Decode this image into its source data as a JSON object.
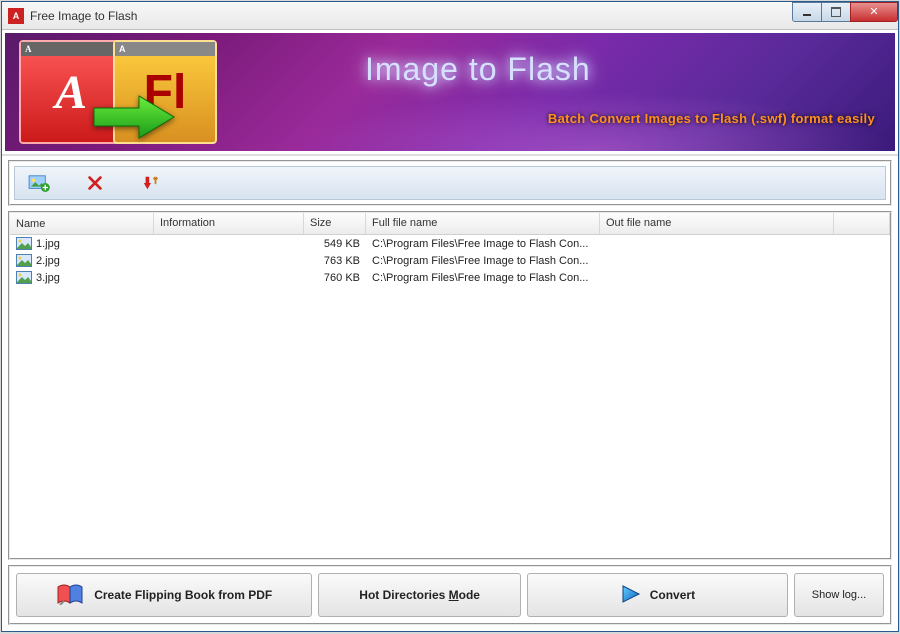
{
  "window": {
    "title": "Free Image to Flash"
  },
  "banner": {
    "title": "Image to Flash",
    "subtitle": "Batch Convert  Images to Flash (.swf) format easily",
    "logo_left_bar": "A",
    "logo_left_text": "A",
    "logo_right_bar": "A",
    "logo_right_text": "Fl"
  },
  "list": {
    "headers": {
      "name": "Name",
      "info": "Information",
      "size": "Size",
      "full": "Full file name",
      "out": "Out file name"
    },
    "rows": [
      {
        "name": "1.jpg",
        "info": "",
        "size": "549 KB",
        "full": "C:\\Program Files\\Free Image to Flash Con...",
        "out": ""
      },
      {
        "name": "2.jpg",
        "info": "",
        "size": "763 KB",
        "full": "C:\\Program Files\\Free Image to Flash Con...",
        "out": ""
      },
      {
        "name": "3.jpg",
        "info": "",
        "size": "760 KB",
        "full": "C:\\Program Files\\Free Image to Flash Con...",
        "out": ""
      }
    ]
  },
  "buttons": {
    "create_book": "Create Flipping Book  from PDF",
    "hot_dirs_pre": "Hot Directories ",
    "hot_dirs_key": "M",
    "hot_dirs_post": "ode",
    "convert": "Convert",
    "show_log": "Show log..."
  }
}
